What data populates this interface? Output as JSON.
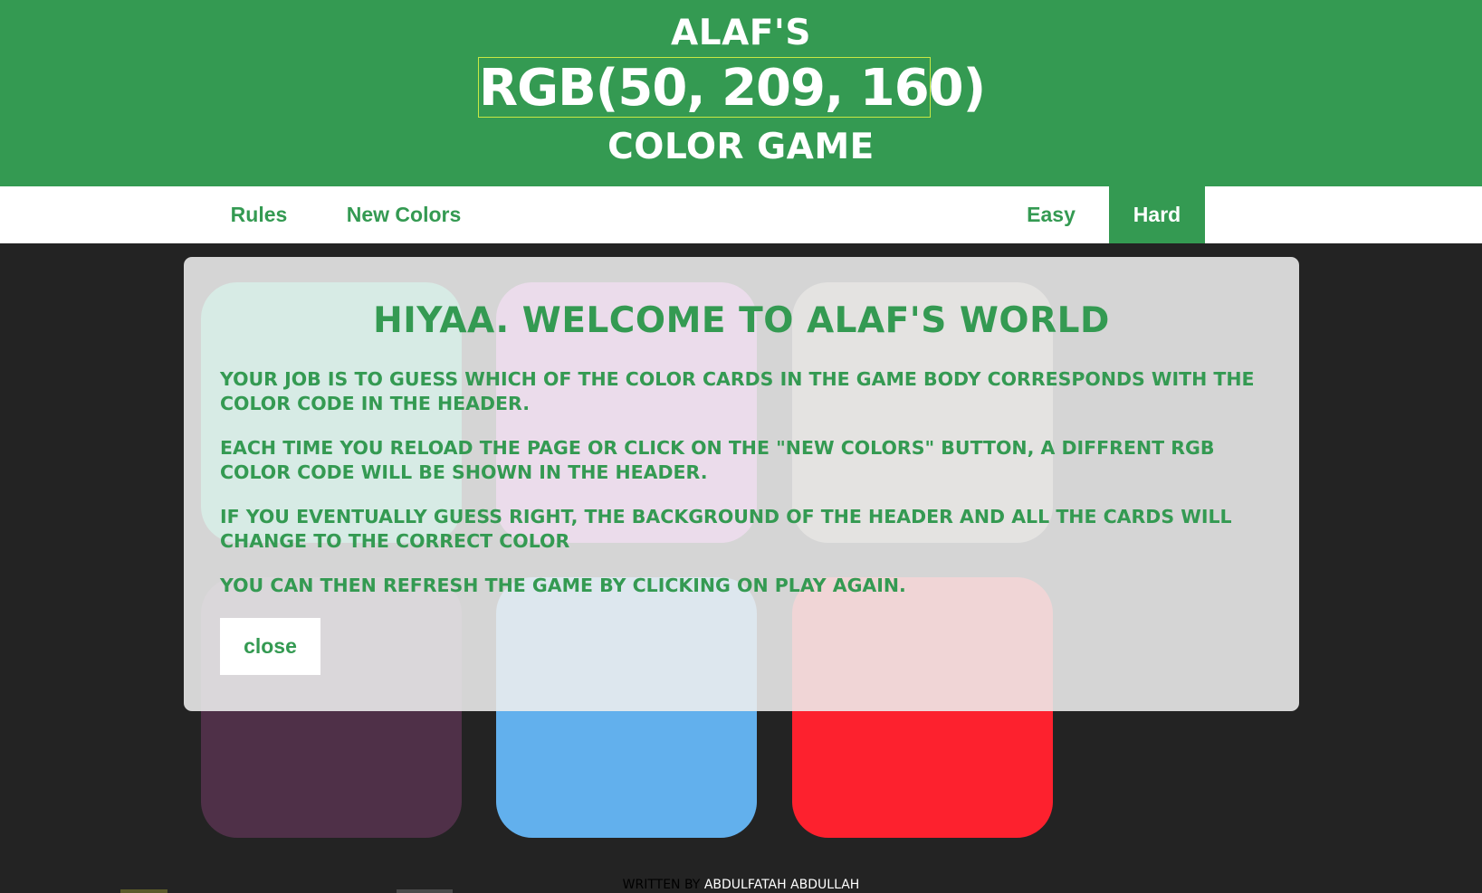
{
  "header": {
    "line1": "ALAF'S",
    "rgb_code": "RGB(50, 209, 160)",
    "line3": "COLOR GAME",
    "background": "#349a52"
  },
  "nav": {
    "rules": "Rules",
    "new_colors": "New Colors",
    "easy": "Easy",
    "hard": "Hard",
    "active_mode": "Hard"
  },
  "cards": [
    {
      "color": "#32d1a0"
    },
    {
      "color": "#d65fd6"
    },
    {
      "color": "#999285"
    },
    {
      "color": "#4f3048"
    },
    {
      "color": "#62b0ed"
    },
    {
      "color": "#fd212e"
    }
  ],
  "modal": {
    "title": "HIYAA. WELCOME TO ALAF'S WORLD",
    "paragraphs": [
      "YOUR JOB IS TO GUESS WHICH OF THE COLOR CARDS IN THE GAME BODY CORRESPONDS WITH THE COLOR CODE IN THE HEADER.",
      "EACH TIME YOU RELOAD THE PAGE OR CLICK ON THE \"NEW COLORS\" BUTTON, A DIFFRENT RGB COLOR CODE WILL BE SHOWN IN THE HEADER.",
      "IF YOU EVENTUALLY GUESS RIGHT, THE BACKGROUND OF THE HEADER AND ALL THE CARDS WILL CHANGE TO THE CORRECT COLOR",
      "YOU CAN THEN REFRESH THE GAME BY CLICKING ON PLAY AGAIN."
    ],
    "close_label": "close"
  },
  "footer": {
    "prefix": "WRITTEN BY ",
    "author": "ABDULFATAH ABDULLAH"
  }
}
